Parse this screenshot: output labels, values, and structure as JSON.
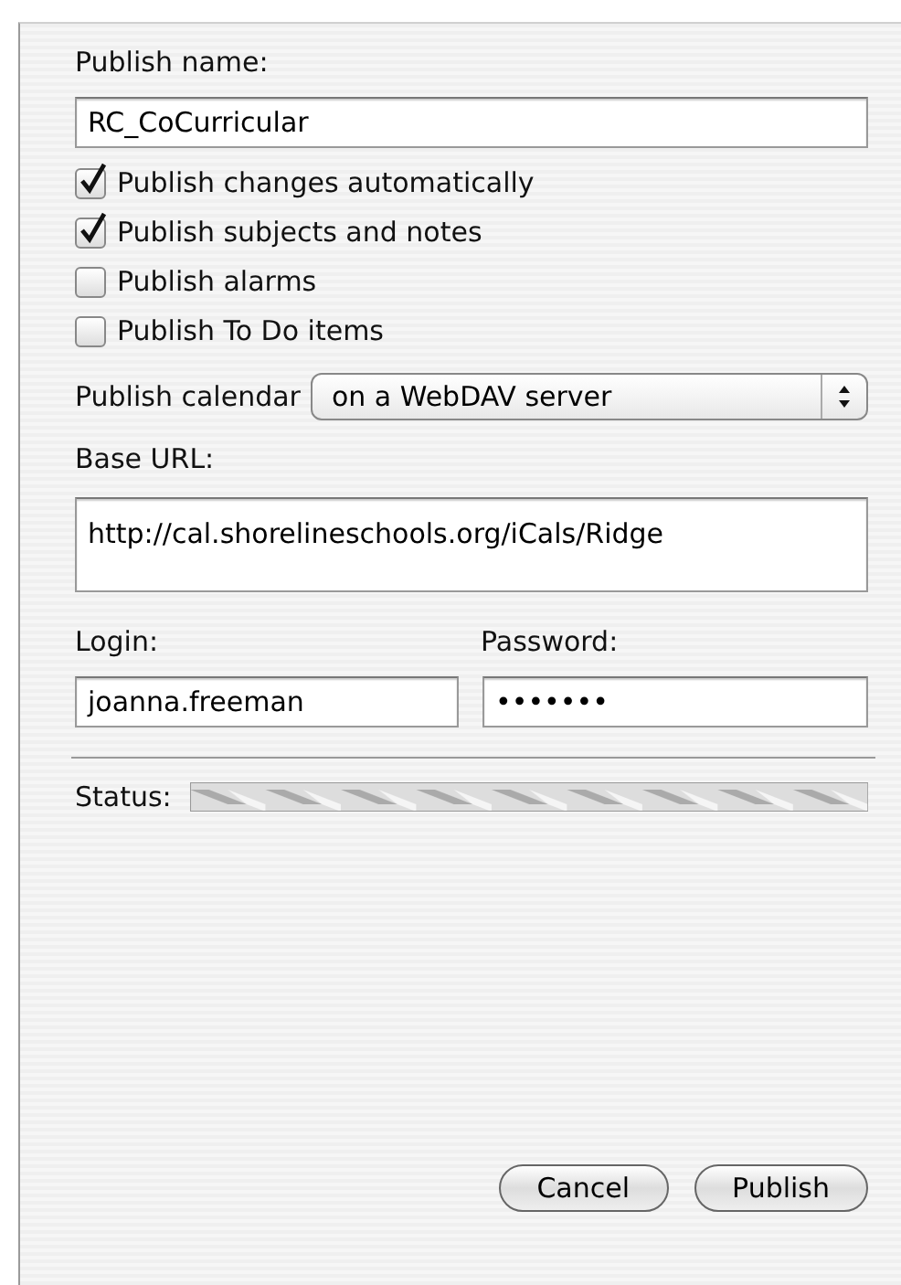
{
  "name_label": "Publish name:",
  "name_value": "RC_CoCurricular",
  "options": [
    {
      "label": "Publish changes automatically",
      "checked": true
    },
    {
      "label": "Publish subjects and notes",
      "checked": true
    },
    {
      "label": "Publish alarms",
      "checked": false
    },
    {
      "label": "Publish To Do items",
      "checked": false
    }
  ],
  "calendar_label": "Publish calendar",
  "calendar_value": "on a WebDAV server",
  "url_label": "Base URL:",
  "url_value": "http://cal.shorelineschools.org/iCals/Ridge",
  "login_label": "Login:",
  "login_value": "joanna.freeman",
  "password_label": "Password:",
  "password_value": "•••••••",
  "status_label": "Status:",
  "status_busy": true,
  "buttons": [
    {
      "label": "Cancel"
    },
    {
      "label": "Publish"
    }
  ]
}
